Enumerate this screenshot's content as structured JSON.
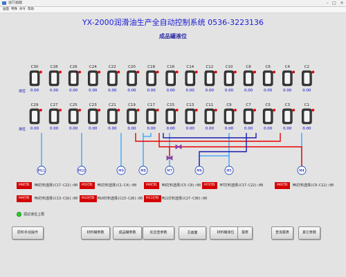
{
  "window": {
    "title": "运行画面"
  },
  "menu": [
    "画面",
    "特殊",
    "命令",
    "帮助"
  ],
  "header": {
    "title": "YX-2000润滑油生产全自动控制系统    0536-3223136",
    "subtitle": "成品罐液位"
  },
  "tanks": {
    "row_label": "液位",
    "top": [
      {
        "name": "C30",
        "value": "0.00"
      },
      {
        "name": "C28",
        "value": "0.00"
      },
      {
        "name": "C26",
        "value": "0.00"
      },
      {
        "name": "C24",
        "value": "0.00"
      },
      {
        "name": "C22",
        "value": "0.00"
      },
      {
        "name": "C20",
        "value": "0.00"
      },
      {
        "name": "C18",
        "value": "0.00"
      },
      {
        "name": "C16",
        "value": "0.00"
      },
      {
        "name": "C14",
        "value": "0.00"
      },
      {
        "name": "C12",
        "value": "0.00"
      },
      {
        "name": "C10",
        "value": "0.00"
      },
      {
        "name": "C8",
        "value": "0.00"
      },
      {
        "name": "C6",
        "value": "0.00"
      },
      {
        "name": "C4",
        "value": "0.00"
      },
      {
        "name": "C2",
        "value": "0.00"
      }
    ],
    "bottom": [
      {
        "name": "C29",
        "value": "0.00"
      },
      {
        "name": "C27",
        "value": "0.00"
      },
      {
        "name": "C25",
        "value": "0.00"
      },
      {
        "name": "C23",
        "value": "0.00"
      },
      {
        "name": "C21",
        "value": "0.00"
      },
      {
        "name": "C19",
        "value": "0.00"
      },
      {
        "name": "C17",
        "value": "0.00"
      },
      {
        "name": "C15",
        "value": "0.00"
      },
      {
        "name": "C13",
        "value": "0.00"
      },
      {
        "name": "C11",
        "value": "0.00"
      },
      {
        "name": "C9",
        "value": "0.00"
      },
      {
        "name": "C7",
        "value": "0.00"
      },
      {
        "name": "C5",
        "value": "0.00"
      },
      {
        "name": "C3",
        "value": "0.00"
      },
      {
        "name": "C1",
        "value": "0.00"
      }
    ]
  },
  "pumps": [
    "M11",
    "M10",
    "M9",
    "M8",
    "M7",
    "M6",
    "M5",
    "M4"
  ],
  "status_rows": [
    [
      {
        "badge": "M8打料",
        "text": "M8打料选择(C17-C22):00"
      },
      {
        "badge": "M5打料",
        "text": "M5打料选择(C1-C4):00"
      },
      {
        "badge": "M9打料",
        "text": "M9打料选择(C5-C8):00"
      },
      {
        "badge": "M7打料",
        "text": "M7打料选择(C17-C22):00"
      },
      {
        "badge": "M6打料",
        "text": "M6打料选择(C9-C12):00"
      }
    ],
    [
      {
        "badge": "M9打料",
        "text": "M9打料选择(C13-C16):00"
      },
      {
        "badge": "M10打料",
        "text": "M10打料选择(C23-C26):00"
      },
      {
        "badge": "M11打料",
        "text": "M11打料选择(C27-C30):00"
      }
    ]
  ],
  "alarm": {
    "text": "润达液位上限",
    "color": "#2bd12b"
  },
  "buttons": [
    "原料手动操作",
    "材料罐参数",
    "成品罐参数",
    "反应釜参数",
    "主画面",
    "材料罐液位",
    "报表",
    "查询报表",
    "其它参数"
  ],
  "colors": {
    "pipe_blue": "#2fa0ff",
    "pipe_red": "#e80000",
    "pipe_navy": "#1a1ab0",
    "title_blue": "#1a1ad8",
    "badge_red": "#d40000"
  }
}
